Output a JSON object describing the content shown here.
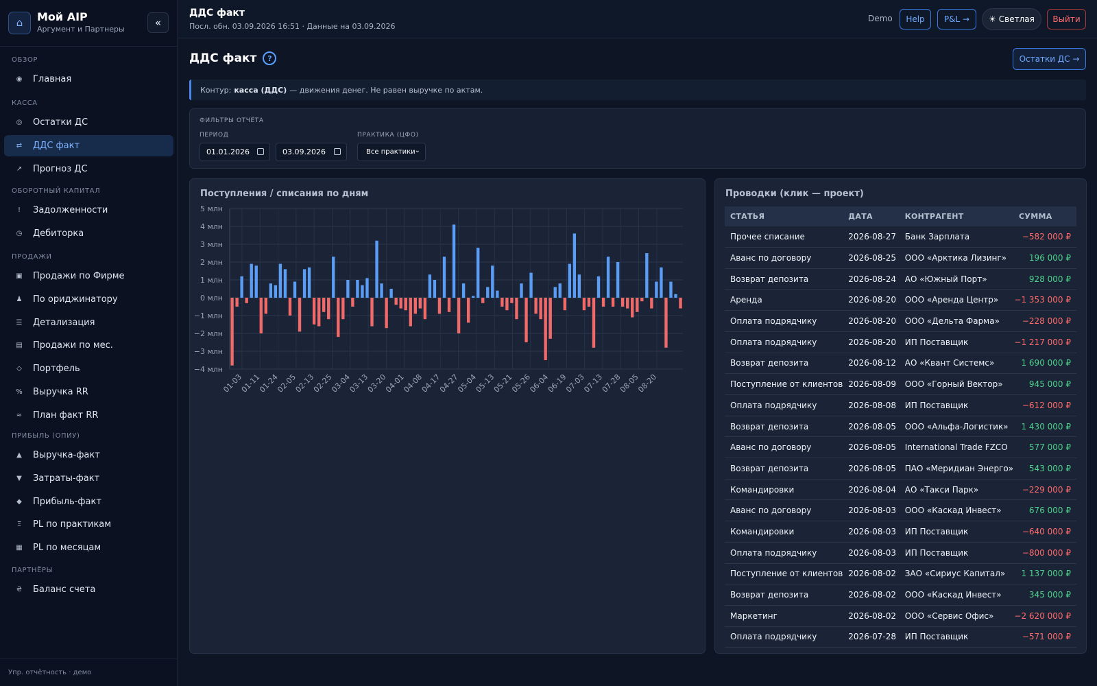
{
  "brand": {
    "icon": "home-icon",
    "title": "Мой AIP",
    "subtitle": "Аргумент и Партнеры",
    "collapse": "«"
  },
  "sidebar": {
    "sections": [
      {
        "label": "ОБЗОР",
        "items": [
          {
            "label": "Главная",
            "icon": "◉"
          }
        ]
      },
      {
        "label": "КАССА",
        "items": [
          {
            "label": "Остатки ДС",
            "icon": "◎"
          },
          {
            "label": "ДДС факт",
            "icon": "⇄",
            "active": true
          },
          {
            "label": "Прогноз ДС",
            "icon": "↗"
          }
        ]
      },
      {
        "label": "ОБОРОТНЫЙ КАПИТАЛ",
        "items": [
          {
            "label": "Задолженности",
            "icon": "!"
          },
          {
            "label": "Дебиторка",
            "icon": "◷"
          }
        ]
      },
      {
        "label": "ПРОДАЖИ",
        "items": [
          {
            "label": "Продажи по Фирме",
            "icon": "▣"
          },
          {
            "label": "По ориджинатору",
            "icon": "♟"
          },
          {
            "label": "Детализация",
            "icon": "☰"
          },
          {
            "label": "Продажи по мес.",
            "icon": "▤"
          },
          {
            "label": "Портфель",
            "icon": "◇"
          },
          {
            "label": "Выручка RR",
            "icon": "%"
          },
          {
            "label": "План факт RR",
            "icon": "≈"
          }
        ]
      },
      {
        "label": "ПРИБЫЛЬ (ОПИУ)",
        "items": [
          {
            "label": "Выручка-факт",
            "icon": "▲"
          },
          {
            "label": "Затраты-факт",
            "icon": "▼"
          },
          {
            "label": "Прибыль-факт",
            "icon": "◆"
          },
          {
            "label": "PL по практикам",
            "icon": "Ξ"
          },
          {
            "label": "PL по месяцам",
            "icon": "▦"
          }
        ]
      },
      {
        "label": "ПАРТНЁРЫ",
        "items": [
          {
            "label": "Баланс счета",
            "icon": "₴"
          }
        ]
      }
    ],
    "footer": "Упр. отчётность · демо"
  },
  "topbar": {
    "title": "ДДС факт",
    "subtitle": "Посл. обн. 03.09.2026 16:51 · Данные на 03.09.2026",
    "demo": "Demo",
    "help": "Help",
    "pl": "P&L →",
    "theme": "☀ Светлая",
    "exit": "Выйти"
  },
  "page": {
    "title": "ДДС факт",
    "help_icon": "?",
    "rest_button": "Остатки ДС →",
    "note_prefix": "Контур:",
    "note_bold": "касса (ДДС)",
    "note_suffix": "— движения денег. Не равен выручке по актам."
  },
  "filters": {
    "title": "ФИЛЬТРЫ ОТЧЁТА",
    "period_label": "ПЕРИОД",
    "date_from": "01.01.2026",
    "date_to": "03.09.2026",
    "practice_label": "ПРАКТИКА (ЦФО)",
    "practice_value": "Все практики"
  },
  "chart": {
    "title": "Поступления / списания по дням",
    "colors": {
      "positive": "#5b9cf5",
      "negative": "#f06a6a"
    }
  },
  "chart_data": {
    "type": "bar",
    "title": "Поступления / списания по дням",
    "ylim": [
      -4,
      5
    ],
    "y_ticks": [
      "5 млн",
      "4 млн",
      "3 млн",
      "2 млн",
      "1 млн",
      "0 млн",
      "−1 млн",
      "−2 млн",
      "−3 млн",
      "−4 млн"
    ],
    "x_tick_labels": [
      "01-03",
      "01-11",
      "01-24",
      "02-05",
      "02-13",
      "02-25",
      "03-04",
      "03-13",
      "03-20",
      "04-01",
      "04-08",
      "04-17",
      "04-27",
      "05-04",
      "05-13",
      "05-21",
      "05-26",
      "06-04",
      "06-19",
      "07-03",
      "07-13",
      "07-28",
      "08-05",
      "08-20"
    ],
    "grid": true,
    "series": [
      {
        "values": [
          -3.8,
          -0.5,
          1.2,
          -0.3,
          1.9,
          1.8,
          -2.0,
          -0.9,
          0.8,
          0.7,
          1.9,
          1.6,
          -1.0,
          0.9,
          -1.9,
          1.6,
          1.7,
          -1.5,
          -1.6,
          -0.8,
          -1.2,
          2.3,
          -2.2,
          -1.2,
          1.0,
          -0.5,
          1.0,
          0.7,
          1.1,
          -1.6,
          3.2,
          0.8,
          -1.7,
          0.5,
          -0.4,
          -0.6,
          -0.7,
          -1.6,
          -0.9,
          -0.6,
          -1.2,
          1.3,
          1.0,
          -0.9,
          2.3,
          -0.8,
          4.1,
          -2.0,
          0.8,
          -1.4,
          0.1,
          2.8,
          -0.3,
          0.6,
          1.8,
          0.4,
          -0.5,
          -0.7,
          -0.3,
          -1.2,
          0.8,
          -2.5,
          1.4,
          -0.9,
          -1.2,
          -3.5,
          -2.3,
          0.6,
          0.8,
          -0.7,
          1.9,
          3.6,
          1.3,
          -0.7,
          -0.5,
          -2.8,
          1.2,
          -0.5,
          2.3,
          -0.5,
          2.0,
          -0.5,
          -0.6,
          -1.1,
          -0.8,
          -0.2,
          2.5,
          -0.6,
          0.9,
          1.7,
          -2.8,
          0.9,
          0.2,
          -0.6
        ]
      }
    ]
  },
  "table": {
    "title": "Проводки (клик — проект)",
    "columns": [
      "СТАТЬЯ",
      "ДАТА",
      "КОНТРАГЕНТ",
      "СУММА"
    ],
    "rows": [
      {
        "item": "Прочее списание",
        "date": "2026-08-27",
        "party": "Банк Зарплата",
        "amount": "−582 000 ₽",
        "sign": "neg"
      },
      {
        "item": "Аванс по договору",
        "date": "2026-08-25",
        "party": "ООО «Арктика Лизинг»",
        "amount": "196 000 ₽",
        "sign": "pos"
      },
      {
        "item": "Возврат депозита",
        "date": "2026-08-24",
        "party": "АО «Южный Порт»",
        "amount": "928 000 ₽",
        "sign": "pos"
      },
      {
        "item": "Аренда",
        "date": "2026-08-20",
        "party": "ООО «Аренда Центр»",
        "amount": "−1 353 000 ₽",
        "sign": "neg"
      },
      {
        "item": "Оплата подрядчику",
        "date": "2026-08-20",
        "party": "ООО «Дельта Фарма»",
        "amount": "−228 000 ₽",
        "sign": "neg"
      },
      {
        "item": "Оплата подрядчику",
        "date": "2026-08-20",
        "party": "ИП Поставщик",
        "amount": "−1 217 000 ₽",
        "sign": "neg"
      },
      {
        "item": "Возврат депозита",
        "date": "2026-08-12",
        "party": "АО «Квант Системс»",
        "amount": "1 690 000 ₽",
        "sign": "pos"
      },
      {
        "item": "Поступление от клиентов",
        "date": "2026-08-09",
        "party": "ООО «Горный Вектор»",
        "amount": "945 000 ₽",
        "sign": "pos"
      },
      {
        "item": "Оплата подрядчику",
        "date": "2026-08-08",
        "party": "ИП Поставщик",
        "amount": "−612 000 ₽",
        "sign": "neg"
      },
      {
        "item": "Возврат депозита",
        "date": "2026-08-05",
        "party": "ООО «Альфа-Логистик»",
        "amount": "1 430 000 ₽",
        "sign": "pos"
      },
      {
        "item": "Аванс по договору",
        "date": "2026-08-05",
        "party": "International Trade FZCO",
        "amount": "577 000 ₽",
        "sign": "pos"
      },
      {
        "item": "Возврат депозита",
        "date": "2026-08-05",
        "party": "ПАО «Меридиан Энерго»",
        "amount": "543 000 ₽",
        "sign": "pos"
      },
      {
        "item": "Командировки",
        "date": "2026-08-04",
        "party": "АО «Такси Парк»",
        "amount": "−229 000 ₽",
        "sign": "neg"
      },
      {
        "item": "Аванс по договору",
        "date": "2026-08-03",
        "party": "ООО «Каскад Инвест»",
        "amount": "676 000 ₽",
        "sign": "pos"
      },
      {
        "item": "Командировки",
        "date": "2026-08-03",
        "party": "ИП Поставщик",
        "amount": "−640 000 ₽",
        "sign": "neg"
      },
      {
        "item": "Оплата подрядчику",
        "date": "2026-08-03",
        "party": "ИП Поставщик",
        "amount": "−800 000 ₽",
        "sign": "neg"
      },
      {
        "item": "Поступление от клиентов",
        "date": "2026-08-02",
        "party": "ЗАО «Сириус Капитал»",
        "amount": "1 137 000 ₽",
        "sign": "pos"
      },
      {
        "item": "Возврат депозита",
        "date": "2026-08-02",
        "party": "ООО «Каскад Инвест»",
        "amount": "345 000 ₽",
        "sign": "pos"
      },
      {
        "item": "Маркетинг",
        "date": "2026-08-02",
        "party": "ООО «Сервис Офис»",
        "amount": "−2 620 000 ₽",
        "sign": "neg"
      },
      {
        "item": "Оплата подрядчику",
        "date": "2026-07-28",
        "party": "ИП Поставщик",
        "amount": "−571 000 ₽",
        "sign": "neg"
      }
    ]
  }
}
